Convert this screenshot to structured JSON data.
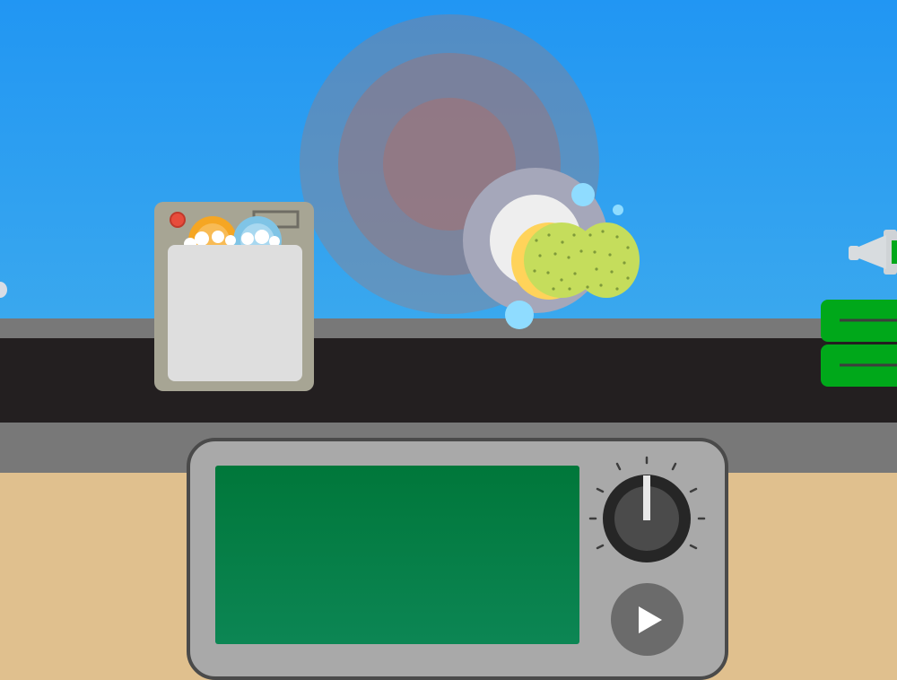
{
  "game": {
    "title": "",
    "screen_text": ""
  },
  "controls": {
    "play_icon": "play-icon",
    "knob_icon": "dial-knob-icon"
  },
  "colors": {
    "sky": "#2196f3",
    "belt": "#231f20",
    "counter": "#787878",
    "floor": "#e0c08e",
    "screen": "#00773a",
    "panel": "#a9a9a9",
    "sponge": "#c5dd5c",
    "bubble": "#8fdcff",
    "pipe": "#00a81a",
    "dishwasher": "#a7a594"
  }
}
